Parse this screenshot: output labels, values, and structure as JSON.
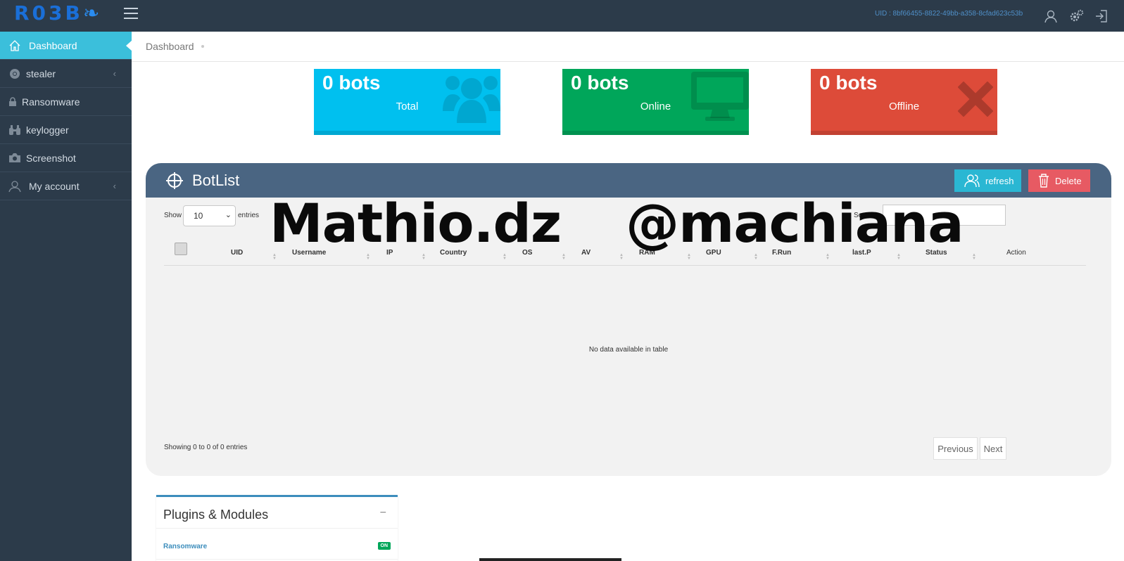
{
  "header": {
    "logo": "R03B",
    "uid": "UID : 8bf66455-8822-49bb-a358-8cfad623c53b"
  },
  "sidebar": {
    "items": [
      {
        "label": "Dashboard",
        "icon": "home-icon",
        "active": true
      },
      {
        "label": "stealer",
        "icon": "chrome-icon",
        "has_submenu": true
      },
      {
        "label": "Ransomware",
        "icon": "lock-icon"
      },
      {
        "label": "keylogger",
        "icon": "binoculars-icon"
      },
      {
        "label": "Screenshot",
        "icon": "camera-icon"
      },
      {
        "label": "My account",
        "icon": "user-icon",
        "has_submenu": true
      }
    ]
  },
  "breadcrumb": {
    "current": "Dashboard"
  },
  "stats": [
    {
      "count": "0 bots",
      "label": "Total",
      "color": "#00c0ef",
      "icon": "users-icon"
    },
    {
      "count": "0 bots",
      "label": "Online",
      "color": "#00a65a",
      "icon": "monitor-icon"
    },
    {
      "count": "0 bots",
      "label": "Offline",
      "color": "#dd4b39",
      "icon": "close-x-icon"
    }
  ],
  "botlist": {
    "title": "BotList",
    "refresh_label": "refresh",
    "delete_label": "Delete",
    "show_label": "Show",
    "entries_value": "10",
    "entries_label": "entries",
    "search_label": "Search:",
    "search_value": "",
    "columns": [
      "UID",
      "Username",
      "IP",
      "Country",
      "OS",
      "AV",
      "RAM",
      "GPU",
      "F.Run",
      "last.P",
      "Status",
      "Action"
    ],
    "empty_text": "No data available in table",
    "info_text": "Showing 0 to 0 of 0 entries",
    "prev_label": "Previous",
    "next_label": "Next"
  },
  "watermark": {
    "left": "Mathio.dz",
    "right": "@machiana"
  },
  "plugins": {
    "title": "Plugins & Modules",
    "collapse_symbol": "−",
    "items": [
      {
        "name": "Ransomware",
        "status": "ON"
      }
    ]
  },
  "colors": {
    "sidebar_bg": "#2c3b4a",
    "accent": "#3bbfdb",
    "panel_header": "#4a6582",
    "refresh_button": "#2ab7d3",
    "delete_button": "#e75a63"
  }
}
